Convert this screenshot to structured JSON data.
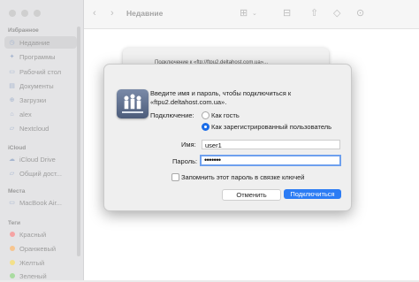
{
  "sidebar": {
    "sections": {
      "favorites": "Избранное",
      "icloud": "iCloud",
      "locations": "Места",
      "tags": "Теги"
    },
    "favorites": [
      {
        "label": "Недавние",
        "icon": "clock-icon"
      },
      {
        "label": "Программы",
        "icon": "apps-icon"
      },
      {
        "label": "Рабочий стол",
        "icon": "desktop-icon"
      },
      {
        "label": "Документы",
        "icon": "document-icon"
      },
      {
        "label": "Загрузки",
        "icon": "download-icon"
      },
      {
        "label": "alex",
        "icon": "home-icon"
      },
      {
        "label": "Nextcloud",
        "icon": "folder-icon"
      }
    ],
    "icloud": [
      {
        "label": "iCloud Drive",
        "icon": "cloud-icon"
      },
      {
        "label": "Общий дост...",
        "icon": "shared-folder-icon"
      }
    ],
    "locations": [
      {
        "label": "MacBook Air...",
        "icon": "laptop-icon"
      }
    ],
    "tags": [
      {
        "label": "Красный",
        "color": "#f5a3a3"
      },
      {
        "label": "Оранжевый",
        "color": "#f7c58f"
      },
      {
        "label": "Желтый",
        "color": "#f3e08a"
      },
      {
        "label": "Зеленый",
        "color": "#a9dba0"
      }
    ]
  },
  "toolbar": {
    "title": "Недавние",
    "icons": [
      "back-icon",
      "forward-icon",
      "grid-view-icon",
      "group-icon",
      "share-icon",
      "tag-icon",
      "more-icon"
    ]
  },
  "background_sheet": {
    "text": "Подключение к «ftp://ftpu2.deltahost.com.ua»..."
  },
  "dialog": {
    "message": "Введите имя и пароль, чтобы подключиться к «ftpu2.deltahost.com.ua».",
    "connect_as_label": "Подключение:",
    "options": [
      "Как гость",
      "Как зарегистрированный пользователь"
    ],
    "selected_option": "Как зарегистрированный пользователь",
    "name_label": "Имя:",
    "name_value": "user1",
    "password_label": "Пароль:",
    "password_value": "•••••••",
    "remember_label": "Запомнить этот пароль в связке ключей",
    "cancel_label": "Отменить",
    "connect_label": "Подключиться",
    "accent_color": "#2c7cf4"
  }
}
